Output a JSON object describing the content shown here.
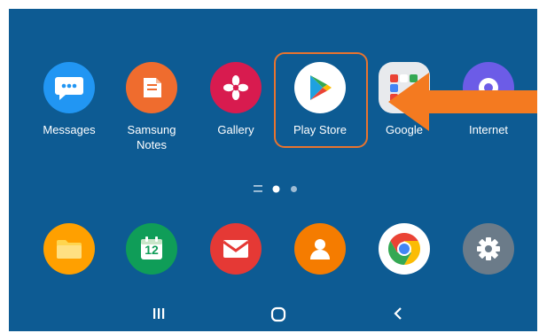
{
  "apps_row1": [
    {
      "label": "Messages",
      "icon": "messages-icon",
      "color": "#2196f3"
    },
    {
      "label": "Samsung\nNotes",
      "icon": "samsung-notes-icon",
      "color": "#ef6c2e"
    },
    {
      "label": "Gallery",
      "icon": "gallery-icon",
      "color": "#d81b4f"
    },
    {
      "label": "Play Store",
      "icon": "play-store-icon",
      "color": "#ffffff"
    },
    {
      "label": "Google",
      "icon": "google-folder-icon",
      "color": "#e8eaed"
    },
    {
      "label": "Internet",
      "icon": "internet-icon",
      "color": "#6c5ce7"
    }
  ],
  "dock": [
    {
      "icon": "my-files-icon",
      "color": "#ffa000"
    },
    {
      "icon": "calendar-icon",
      "color": "#0f9d58",
      "text": "12"
    },
    {
      "icon": "email-icon",
      "color": "#e53935"
    },
    {
      "icon": "contacts-icon",
      "color": "#f57c00"
    },
    {
      "icon": "chrome-icon",
      "color": "#ffffff"
    },
    {
      "icon": "settings-icon",
      "color": "#6b7b89"
    }
  ],
  "highlight_color": "#e8742f",
  "arrow_color": "#f47a20",
  "background_color": "#0d5b93",
  "page_indicator": {
    "pages": 2,
    "active": 1
  },
  "nav_bar": [
    "recent-apps-icon",
    "home-icon",
    "back-icon"
  ]
}
